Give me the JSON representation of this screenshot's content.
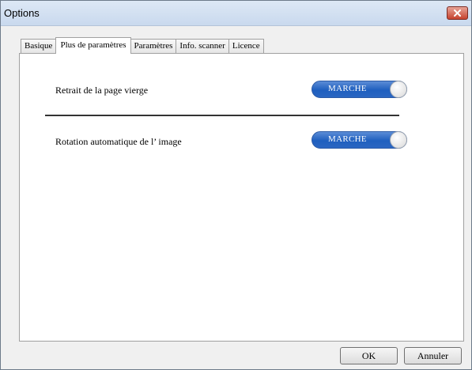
{
  "window": {
    "title": "Options"
  },
  "tabs": [
    {
      "label": "Basique",
      "active": false
    },
    {
      "label": "Plus de paramètres",
      "active": true
    },
    {
      "label": "Paramètres",
      "active": false
    },
    {
      "label": "Info. scanner",
      "active": false
    },
    {
      "label": "Licence",
      "active": false
    }
  ],
  "settings": {
    "blank_page_removal": {
      "label": "Retrait de la page vierge",
      "toggle": "MARCHE",
      "on": true
    },
    "auto_rotation": {
      "label": "Rotation automatique de l’ image",
      "toggle": "MARCHE",
      "on": true
    }
  },
  "buttons": {
    "ok": "OK",
    "cancel": "Annuler"
  },
  "colors": {
    "toggle_on": "#1f5fbf",
    "close_button": "#c7432f",
    "titlebar": "#c9d9ee"
  }
}
